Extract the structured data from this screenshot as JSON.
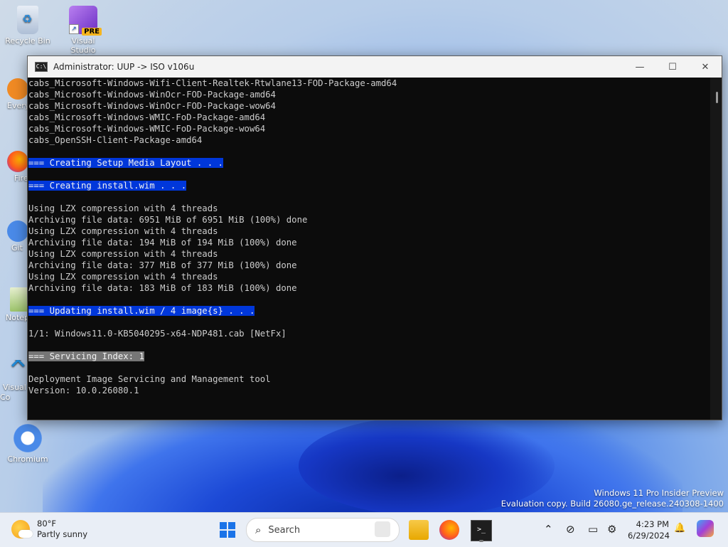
{
  "desktop": {
    "icons": [
      {
        "label": "Recycle Bin"
      },
      {
        "label": "Visual Studio",
        "badge": "PRE"
      },
      {
        "label": "Every"
      },
      {
        "label": "Fire"
      },
      {
        "label": "Git"
      },
      {
        "label": "Notep"
      },
      {
        "label": "Visual Co"
      },
      {
        "label": "Chromium"
      }
    ],
    "watermark": {
      "line1": "Windows 11 Pro Insider Preview",
      "line2": "Evaluation copy. Build 26080.ge_release.240308-1400"
    }
  },
  "window": {
    "title": "Administrator:  UUP -> ISO v106u",
    "icon_text": "C:\\",
    "controls": {
      "minimize": "—",
      "maximize": "☐",
      "close": "✕"
    },
    "lines": [
      {
        "text": "cabs_Microsoft-Windows-Wifi-Client-Realtek-Rtwlane13-FOD-Package-amd64",
        "hl": ""
      },
      {
        "text": "cabs_Microsoft-Windows-WinOcr-FOD-Package-amd64",
        "hl": ""
      },
      {
        "text": "cabs_Microsoft-Windows-WinOcr-FOD-Package-wow64",
        "hl": ""
      },
      {
        "text": "cabs_Microsoft-Windows-WMIC-FoD-Package-amd64",
        "hl": ""
      },
      {
        "text": "cabs_Microsoft-Windows-WMIC-FoD-Package-wow64",
        "hl": ""
      },
      {
        "text": "cabs_OpenSSH-Client-Package-amd64",
        "hl": ""
      },
      {
        "text": "",
        "hl": ""
      },
      {
        "text": "=== Creating Setup Media Layout . . .",
        "hl": "blue"
      },
      {
        "text": "",
        "hl": ""
      },
      {
        "text": "=== Creating install.wim . . .",
        "hl": "blue"
      },
      {
        "text": "",
        "hl": ""
      },
      {
        "text": "Using LZX compression with 4 threads",
        "hl": ""
      },
      {
        "text": "Archiving file data: 6951 MiB of 6951 MiB (100%) done",
        "hl": ""
      },
      {
        "text": "Using LZX compression with 4 threads",
        "hl": ""
      },
      {
        "text": "Archiving file data: 194 MiB of 194 MiB (100%) done",
        "hl": ""
      },
      {
        "text": "Using LZX compression with 4 threads",
        "hl": ""
      },
      {
        "text": "Archiving file data: 377 MiB of 377 MiB (100%) done",
        "hl": ""
      },
      {
        "text": "Using LZX compression with 4 threads",
        "hl": ""
      },
      {
        "text": "Archiving file data: 183 MiB of 183 MiB (100%) done",
        "hl": ""
      },
      {
        "text": "",
        "hl": ""
      },
      {
        "text": "=== Updating install.wim / 4 image{s} . . .",
        "hl": "blue"
      },
      {
        "text": "",
        "hl": ""
      },
      {
        "text": "1/1: Windows11.0-KB5040295-x64-NDP481.cab [NetFx]",
        "hl": ""
      },
      {
        "text": "",
        "hl": ""
      },
      {
        "text": "=== Servicing Index: 1",
        "hl": "gray"
      },
      {
        "text": "",
        "hl": ""
      },
      {
        "text": "Deployment Image Servicing and Management tool",
        "hl": ""
      },
      {
        "text": "Version: 10.0.26080.1",
        "hl": ""
      }
    ]
  },
  "taskbar": {
    "weather": {
      "temp": "80°F",
      "condition": "Partly sunny"
    },
    "search_label": "Search",
    "search_glyph": "⌕",
    "terminal_glyph": ">_",
    "tray_glyphs": {
      "chevron": "⌃",
      "network": "⊘",
      "display": "▭",
      "settings": "⚙",
      "bell": "🔔"
    },
    "clock": {
      "time": "4:23 PM",
      "date": "6/29/2024"
    }
  }
}
